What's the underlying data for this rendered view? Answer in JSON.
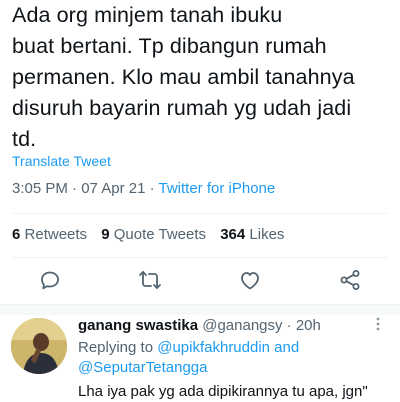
{
  "tweet": {
    "text_lines": [
      "Ada org minjem tanah ibuku",
      "buat bertani. Tp dibangun rumah",
      "permanen. Klo mau ambil tanahnya",
      "disuruh bayarin rumah yg udah jadi",
      "td."
    ],
    "translate_label": "Translate Tweet",
    "time": "3:05 PM",
    "separator": " · ",
    "date": "07 Apr 21",
    "source": "Twitter for iPhone"
  },
  "stats": {
    "retweets_count": "6",
    "retweets_label": "Retweets",
    "quotes_count": "9",
    "quotes_label": "Quote Tweets",
    "likes_count": "364",
    "likes_label": "Likes"
  },
  "actions": {
    "icons": [
      "reply-icon",
      "retweet-icon",
      "like-icon",
      "share-icon"
    ],
    "icon_color": "#536471"
  },
  "reply": {
    "display_name": "ganang swastika",
    "handle": "@ganangsy",
    "separator": " · ",
    "age": "20h",
    "replying_prefix": "Replying to ",
    "mention_1": "@upikfakhruddin",
    "connector": " and",
    "mention_2": "@SeputarTetangga",
    "text": "Lha iya pak yg ada dipikirannya tu apa, jgn\""
  },
  "colors": {
    "accent": "#1d9bf0",
    "text": "#0f1419",
    "secondary": "#536471"
  }
}
